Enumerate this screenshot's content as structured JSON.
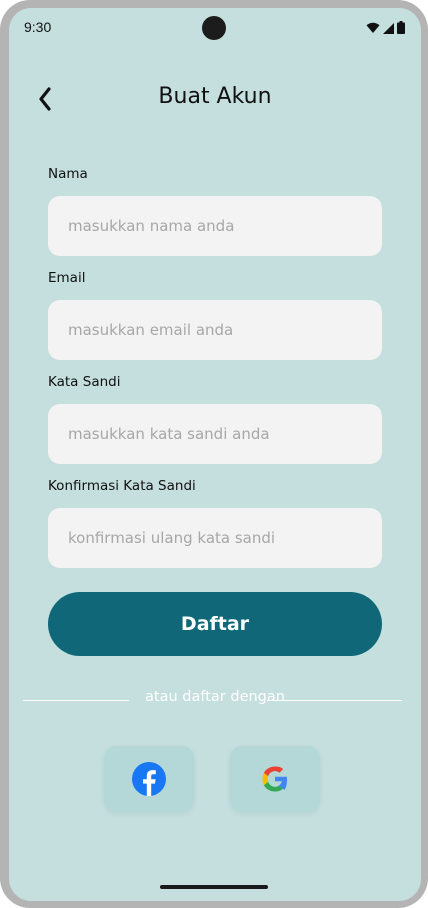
{
  "status_bar": {
    "time": "9:30"
  },
  "header": {
    "title": "Buat Akun",
    "back_icon": "chevron-left-icon"
  },
  "form": {
    "name": {
      "label": "Nama",
      "placeholder": "masukkan nama anda",
      "value": ""
    },
    "email": {
      "label": "Email",
      "placeholder": "masukkan email anda",
      "value": ""
    },
    "password": {
      "label": "Kata Sandi",
      "placeholder": "masukkan kata sandi anda",
      "value": ""
    },
    "confirm": {
      "label": "Konfirmasi Kata Sandi",
      "placeholder": "konfirmasi ulang kata sandi",
      "value": ""
    }
  },
  "submit": {
    "label": "Daftar"
  },
  "alt_signup": {
    "divider_text": "atau daftar dengan",
    "providers": [
      {
        "icon": "facebook-icon"
      },
      {
        "icon": "google-icon"
      }
    ]
  },
  "colors": {
    "background": "#c4dfde",
    "input_bg": "#f3f3f3",
    "primary": "#0f6778",
    "social_bg": "#b4d7d7"
  }
}
